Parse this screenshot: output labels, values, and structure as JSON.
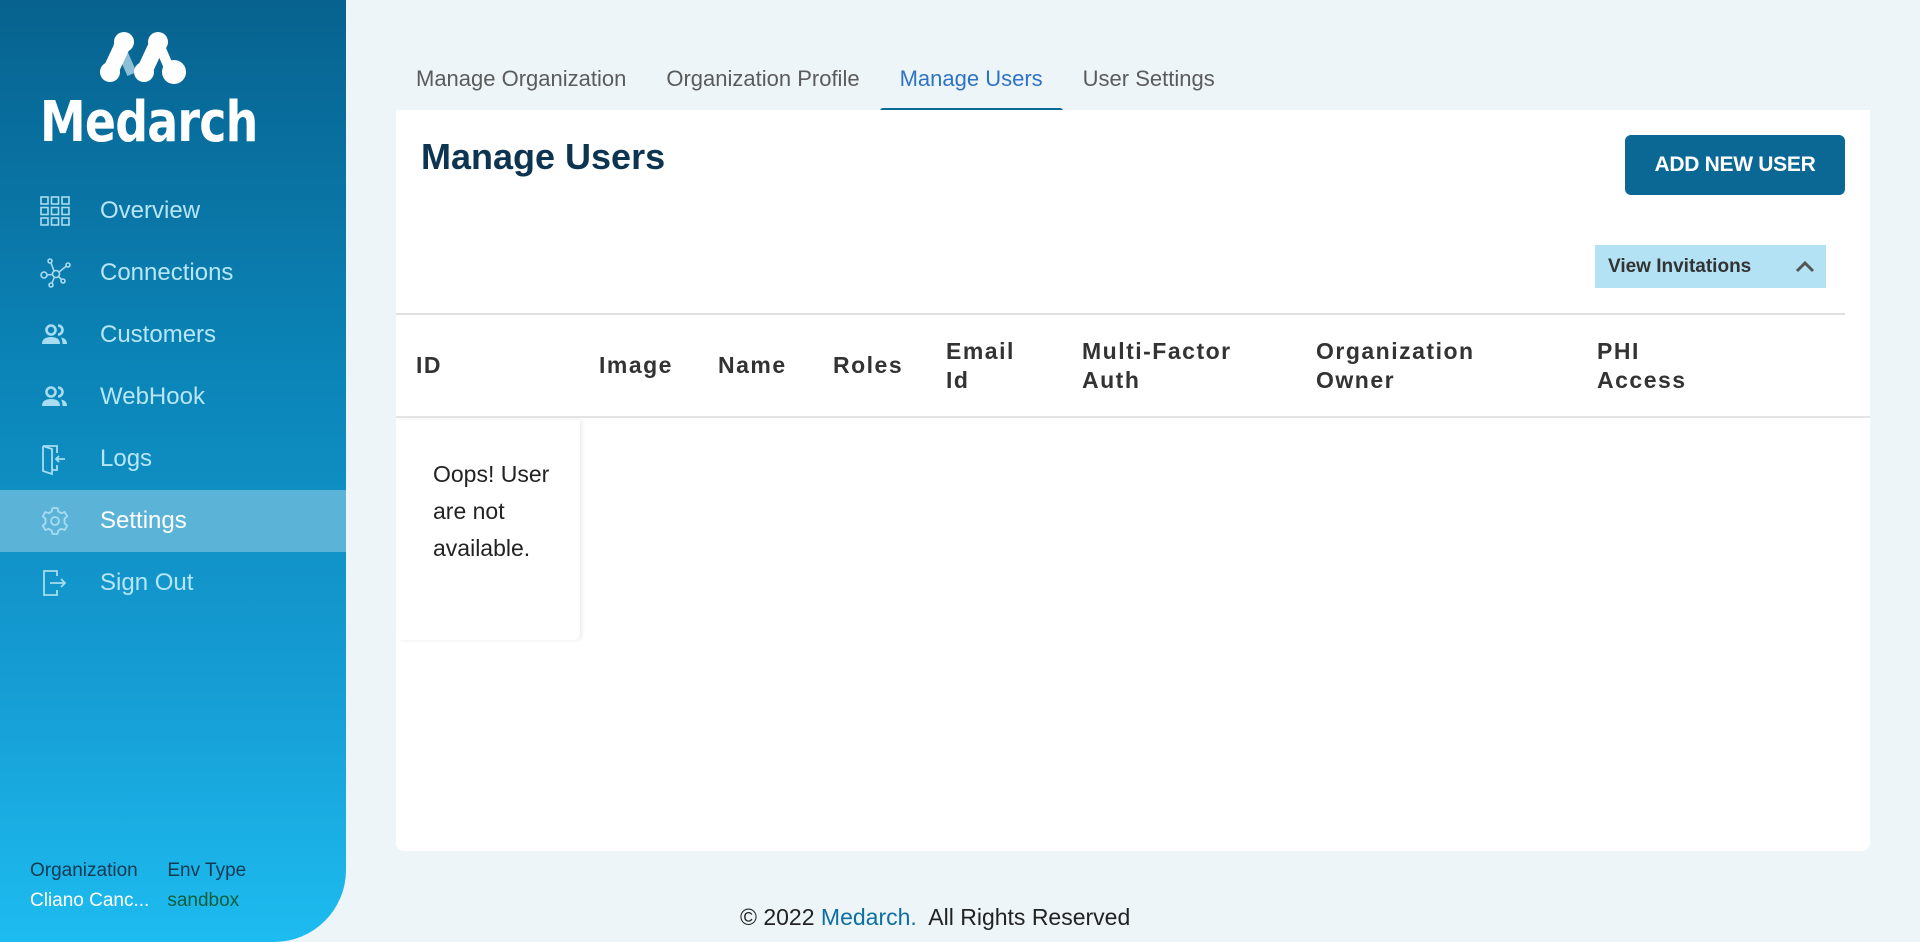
{
  "brand": {
    "name": "Medarch"
  },
  "sidebar": {
    "items": [
      {
        "label": "Overview",
        "icon": "grid-icon",
        "active": false
      },
      {
        "label": "Connections",
        "icon": "network-icon",
        "active": false
      },
      {
        "label": "Customers",
        "icon": "users-icon",
        "active": false
      },
      {
        "label": "WebHook",
        "icon": "users-icon",
        "active": false
      },
      {
        "label": "Logs",
        "icon": "door-enter-icon",
        "active": false
      },
      {
        "label": "Settings",
        "icon": "gear-icon",
        "active": true
      },
      {
        "label": "Sign Out",
        "icon": "sign-out-icon",
        "active": false
      }
    ],
    "footer": {
      "org_label": "Organization",
      "org_value": "Cliano Canc...",
      "env_label": "Env Type",
      "env_value": "sandbox"
    }
  },
  "tabs": [
    {
      "label": "Manage Organization",
      "active": false
    },
    {
      "label": "Organization Profile",
      "active": false
    },
    {
      "label": "Manage Users",
      "active": true
    },
    {
      "label": "User Settings",
      "active": false
    }
  ],
  "main": {
    "title": "Manage Users",
    "add_button": "ADD NEW USER",
    "view_invitations": "View Invitations",
    "table": {
      "columns": [
        "ID",
        "Image",
        "Name",
        "Roles",
        "Email Id",
        "Multi-Factor Auth",
        "Organization Owner",
        "PHI Access"
      ],
      "empty_message": "Oops! User are not available."
    }
  },
  "footer": {
    "prefix": "© 2022 ",
    "brand": "Medarch.",
    "suffix": "  All Rights Reserved"
  },
  "colors": {
    "accent": "#0b6794",
    "active_tab": "#2e73c4",
    "sidebar_active": "#5bb4d8"
  }
}
